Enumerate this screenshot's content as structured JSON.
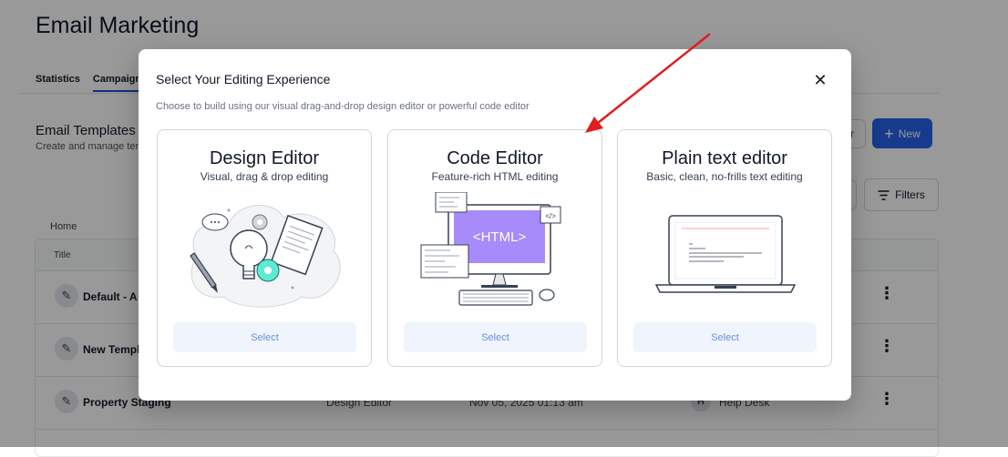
{
  "page": {
    "title": "Email Marketing",
    "tabs": [
      "Statistics",
      "Campaigns"
    ],
    "active_tab": "Campaigns",
    "section_title": "Email Templates",
    "section_subtitle": "Create and manage templates",
    "outline_button_label": "r",
    "new_button_label": "New",
    "filters_label": "Filters",
    "breadcrumb": "Home",
    "table_header_title": "Title",
    "rows": [
      {
        "name": "Default - A",
        "type": "",
        "date": "",
        "owner_initial": "",
        "owner": ""
      },
      {
        "name": "New Templ",
        "type": "",
        "date": "",
        "owner_initial": "",
        "owner": ""
      },
      {
        "name": "Property Staging",
        "type": "Design Editor",
        "date": "Nov 05, 2025 01:13 am",
        "owner_initial": "H",
        "owner": "Help Desk"
      }
    ]
  },
  "modal": {
    "title": "Select Your Editing Experience",
    "subtitle": "Choose to build using our visual drag-and-drop design editor or powerful code editor",
    "close_symbol": "✕",
    "cards": [
      {
        "title": "Design Editor",
        "desc": "Visual, drag & drop editing",
        "button": "Select",
        "icon": "design-illustration"
      },
      {
        "title": "Code Editor",
        "desc": "Feature-rich HTML editing",
        "button": "Select",
        "icon": "code-illustration",
        "illus_text": "<HTML>",
        "tag_text": "</>"
      },
      {
        "title": "Plain text editor",
        "desc": "Basic, clean, no-frills text editing",
        "button": "Select",
        "icon": "laptop-illustration"
      }
    ]
  },
  "colors": {
    "primary": "#2563eb",
    "select_bg": "#eff4fd",
    "select_text": "#6b8fd6",
    "code_purple": "#a78bfa",
    "gear_teal": "#5eead4",
    "annotation_arrow": "#e11d1d"
  }
}
